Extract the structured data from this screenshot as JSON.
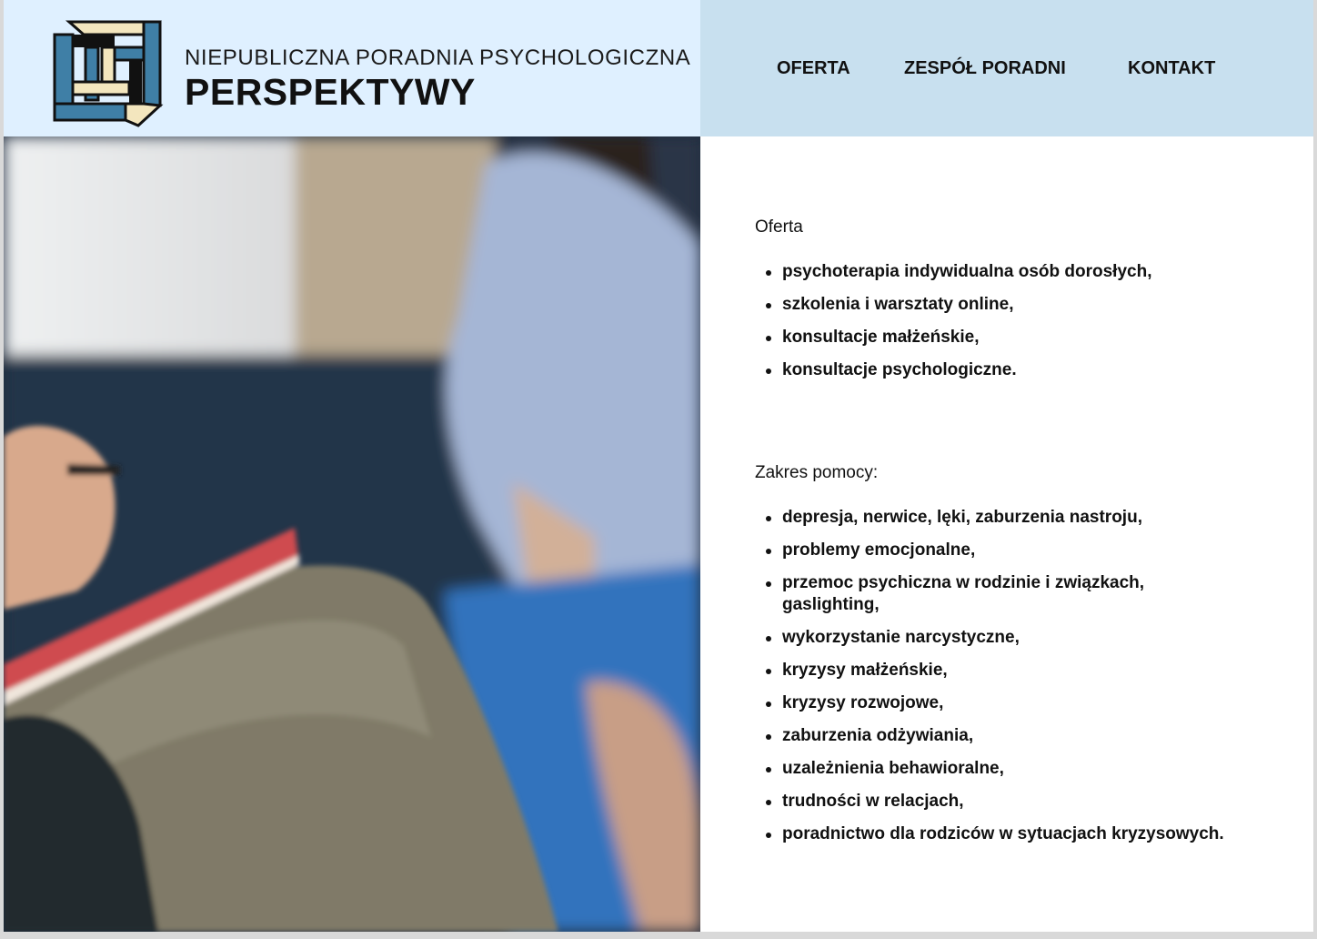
{
  "header": {
    "subtitle": "NIEPUBLICZNA PORADNIA PSYCHOLOGICZNA",
    "title": "PERSPEKTYWY",
    "logo_icon": "impossible-cube-icon",
    "colors": {
      "brand_bg": "#dff0ff",
      "nav_bg": "#c8e0ef",
      "logo_blue": "#3f7fa6",
      "logo_cream": "#f3e6be"
    }
  },
  "nav": {
    "items": [
      {
        "label": "OFERTA"
      },
      {
        "label": "ZESPÓŁ PORADNI"
      },
      {
        "label": "KONTAKT"
      }
    ]
  },
  "hero_image": {
    "icon": "therapy-session-photo"
  },
  "offer": {
    "heading": "Oferta",
    "items": [
      "psychoterapia indywidualna osób dorosłych,",
      "szkolenia i warsztaty online,",
      "konsultacje małżeńskie,",
      "konsultacje psychologiczne."
    ]
  },
  "help": {
    "heading": "Zakres pomocy:",
    "items": [
      "depresja, nerwice, lęki, zaburzenia nastroju,",
      "problemy emocjonalne,",
      "przemoc psychiczna w rodzinie i związkach, gaslighting,",
      "wykorzystanie narcystyczne,",
      "kryzysy małżeńskie,",
      "kryzysy rozwojowe,",
      "zaburzenia odżywiania,",
      "uzależnienia behawioralne,",
      "trudności w relacjach,",
      "poradnictwo dla rodziców w sytuacjach kryzysowych."
    ]
  }
}
